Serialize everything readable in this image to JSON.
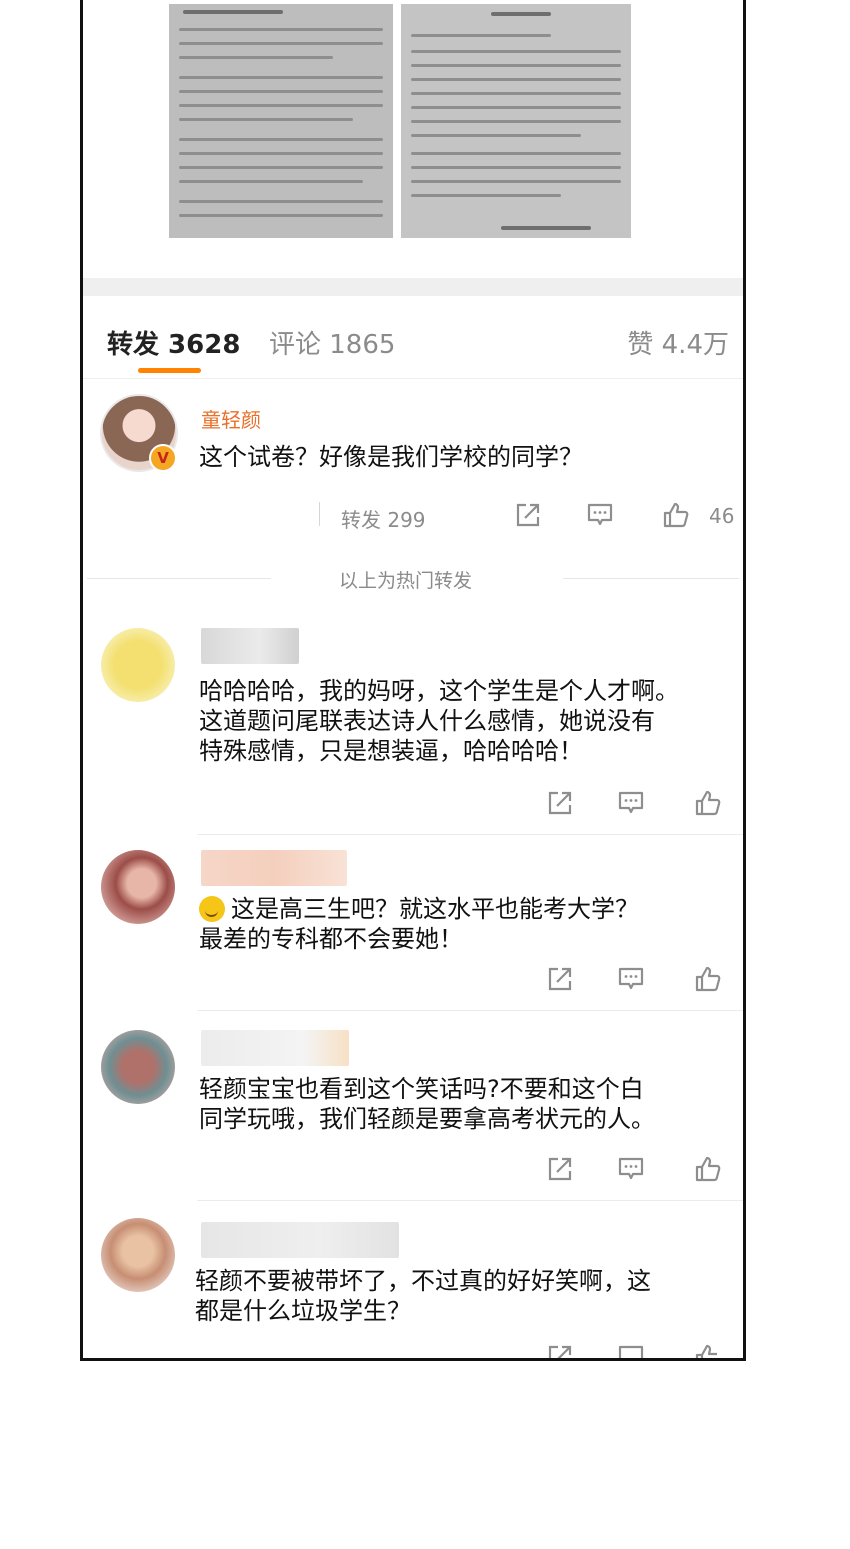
{
  "tabs": {
    "reposts": "转发 3628",
    "comments": "评论 1865",
    "likes": "赞 4.4万"
  },
  "hot_repost": {
    "author": "童轻颜",
    "badge": "V",
    "text": "这个试卷？好像是我们学校的同学？",
    "repost_count": "转发 299",
    "like_count": "46"
  },
  "section_label": "以上为热门转发",
  "comments": [
    {
      "lines": [
        "哈哈哈哈，我的妈呀，这个学生是个人才啊。",
        "这道题问尾联表达诗人什么感情，她说没有",
        "特殊感情，只是想装逼，哈哈哈哈！"
      ]
    },
    {
      "lines": [
        "这是高三生吧？就这水平也能考大学？",
        "最差的专科都不会要她！"
      ]
    },
    {
      "lines": [
        "轻颜宝宝也看到这个笑话吗?不要和这个白",
        "同学玩哦，我们轻颜是要拿高考状元的人。"
      ]
    },
    {
      "lines": [
        "轻颜不要被带坏了，不过真的好好笑啊，这",
        "都是什么垃圾学生？"
      ]
    }
  ],
  "icons": [
    "share-icon",
    "comment-icon",
    "like-icon",
    "smile-emoji-icon",
    "verified-icon"
  ],
  "colors": {
    "accent": "#ff8200",
    "author": "#e8702a",
    "muted": "#8b8b8b"
  }
}
